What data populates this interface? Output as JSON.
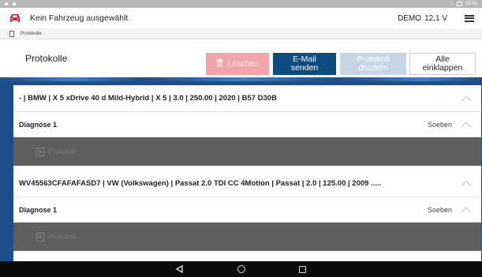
{
  "status_bar": {
    "time": "01:01"
  },
  "header": {
    "vehicle_status": "Kein Fahrzeug ausgewählt",
    "mode": "DEMO",
    "voltage": "12,1 V",
    "car_icon": "car-icon",
    "menu_icon": "hamburger-menu-icon"
  },
  "breadcrumb": {
    "label": "Protokolle"
  },
  "toolbar": {
    "title": "Protokolle",
    "delete_label": "Löschen",
    "email_label": "E-Mail senden",
    "print_label": "Protokoll drucken",
    "collapse_label": "Alle einklappen"
  },
  "entries": [
    {
      "vehicle": "- | BMW | X 5 xDrive 40 d Mild-Hybrid | X 5 | 3.0 | 250.00 | 2020 | B57 D30B",
      "diagnosis": "Diagnose 1",
      "time": "Soeben",
      "protocol": "Protokoll"
    },
    {
      "vehicle": "WV45563CFAFAFASD7 | VW (Volkswagen) | Passat 2.0 TDI CC 4Motion | Passat | 2.0 | 125.00 | 2009 .....",
      "diagnosis": "Diagnose 1",
      "time": "Soeben",
      "protocol": "Protokoll"
    }
  ],
  "colors": {
    "brand_red": "#d21d2b",
    "primary_blue": "#0d4b80",
    "band_blue": "#1d4e87",
    "disabled_red": "#f2a4a8",
    "disabled_blue": "#c6d6e6"
  }
}
